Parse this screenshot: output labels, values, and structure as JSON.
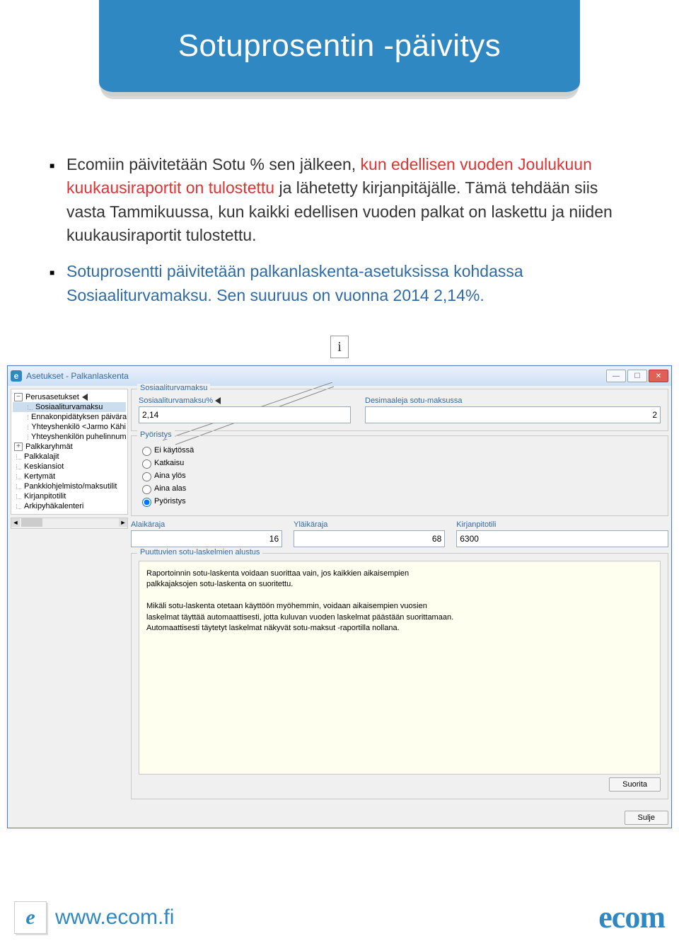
{
  "title": "Sotuprosentin -päivitys",
  "bullets": [
    {
      "pre_black1": "Ecomiin päivitetään Sotu % sen jälkeen, ",
      "red": "kun edellisen vuoden Joulukuun kuukausiraportit on tulostettu",
      "post_black1": " ja lähetetty kirjanpitäjälle. Tämä tehdään siis vasta Tammikuussa, kun kaikki edellisen vuoden palkat on laskettu ja niiden kuukausiraportit tulostettu."
    },
    {
      "blue": "Sotuprosentti päivitetään palkanlaskenta-asetuksissa kohdassa Sosiaaliturvamaksu. Sen suuruus on vuonna 2014 2,14%."
    }
  ],
  "i_char": "i",
  "window": {
    "title": "Asetukset - Palkanlaskenta",
    "tree": {
      "root1": "Perusasetukset",
      "root1_children": [
        "Sosiaaliturvamaksu",
        "Ennakonpidätyksen päivära",
        "Yhteyshenkilö <Jarmo Kähi",
        "Yhteyshenkilön puhelinnum"
      ],
      "root2": "Palkkaryhmät",
      "rest": [
        "Palkkalajit",
        "Keskiansiot",
        "Kertymät",
        "Pankkiohjelmisto/maksutilit",
        "Kirjanpitotilit",
        "Arkipyhäkalenteri"
      ]
    },
    "form": {
      "group1_label": "Sosiaaliturvamaksu",
      "sotu_label": "Sosiaaliturvamaksu%",
      "sotu_value": "2,14",
      "decimals_label": "Desimaaleja sotu-maksussa",
      "decimals_value": "2",
      "rounding_label": "Pyöristys",
      "rounding_options": [
        "Ei käytössä",
        "Katkaisu",
        "Aina ylös",
        "Aina alas",
        "Pyöristys"
      ],
      "rounding_selected_index": 4,
      "limits": {
        "ala_label": "Alaikäraja",
        "ala_value": "16",
        "yla_label": "Yläikäraja",
        "yla_value": "68",
        "tili_label": "Kirjanpitotili",
        "tili_value": "6300"
      },
      "missing_group_label": "Puuttuvien sotu-laskelmien alustus",
      "missing_text1": "Raportoinnin sotu-laskenta voidaan suorittaa vain, jos kaikkien aikaisempien palkkajaksojen sotu-laskenta on suoritettu.",
      "missing_text2": "Mikäli sotu-laskenta otetaan käyttöön myöhemmin, voidaan aikaisempien vuosien laskelmat täyttää automaattisesti, jotta kuluvan vuoden laskelmat päästään suorittamaan. Automaattisesti täytetyt laskelmat näkyvät sotu-maksut -raportilla nollana.",
      "btn_run": "Suorita",
      "btn_close": "Sulje"
    }
  },
  "footer": {
    "url": "www.ecom.fi",
    "logo": "ecom",
    "ico": "e"
  }
}
